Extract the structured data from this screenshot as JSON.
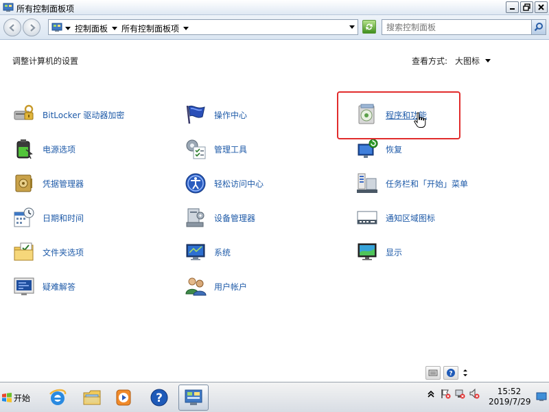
{
  "window": {
    "title": "所有控制面板项",
    "buttons": {
      "minimize": "minimize",
      "maximize": "maximize",
      "close": "close"
    }
  },
  "address": {
    "crumbs": [
      "控制面板",
      "所有控制面板项"
    ],
    "search_placeholder": "搜索控制面板"
  },
  "content": {
    "heading": "调整计算机的设置",
    "view_by_label": "查看方式:",
    "view_by_value": "大图标",
    "items": [
      {
        "label": "BitLocker 驱动器加密",
        "icon": "bitlocker-icon"
      },
      {
        "label": "操作中心",
        "icon": "action-center-flag-icon"
      },
      {
        "label": "程序和功能",
        "icon": "programs-features-icon"
      },
      {
        "label": "电源选项",
        "icon": "power-battery-icon"
      },
      {
        "label": "管理工具",
        "icon": "admin-tools-icon"
      },
      {
        "label": "恢复",
        "icon": "recovery-icon"
      },
      {
        "label": "凭据管理器",
        "icon": "credential-vault-icon"
      },
      {
        "label": "轻松访问中心",
        "icon": "ease-of-access-icon"
      },
      {
        "label": "任务栏和「开始」菜单",
        "icon": "taskbar-start-icon"
      },
      {
        "label": "日期和时间",
        "icon": "calendar-clock-icon"
      },
      {
        "label": "设备管理器",
        "icon": "device-manager-icon"
      },
      {
        "label": "通知区域图标",
        "icon": "notification-area-icon"
      },
      {
        "label": "文件夹选项",
        "icon": "folder-options-icon"
      },
      {
        "label": "系统",
        "icon": "system-monitor-icon"
      },
      {
        "label": "显示",
        "icon": "display-monitor-icon"
      },
      {
        "label": "疑难解答",
        "icon": "troubleshooting-icon"
      },
      {
        "label": "用户帐户",
        "icon": "user-accounts-icon"
      }
    ]
  },
  "taskbar": {
    "start_label": "开始",
    "clock_time": "15:52",
    "clock_date": "2019/7/29"
  },
  "colors": {
    "link": "#1e5aa8",
    "highlight": "#e12b2b",
    "titlebar_top": "#ffffff",
    "titlebar_bottom": "#dfe8f3"
  }
}
